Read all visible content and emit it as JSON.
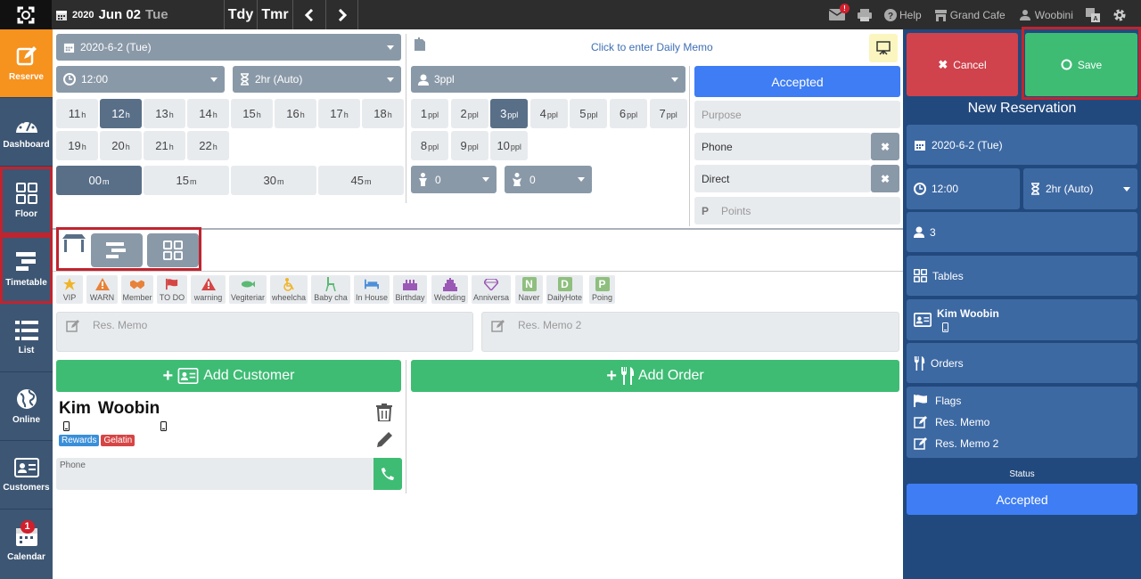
{
  "topbar": {
    "year": "2020",
    "date": "Jun 02",
    "weekday": "Tue",
    "today_label": "Tdy",
    "tomorrow_label": "Tmr",
    "mail_badge": "!",
    "help_label": "Help",
    "venue_label": "Grand Cafe",
    "user_label": "Woobini"
  },
  "sidebar": {
    "items": [
      {
        "label": "Reserve"
      },
      {
        "label": "Dashboard"
      },
      {
        "label": "Floor"
      },
      {
        "label": "Timetable"
      },
      {
        "label": "List"
      },
      {
        "label": "Online"
      },
      {
        "label": "Customers"
      },
      {
        "label": "Calendar",
        "badge": "1"
      }
    ]
  },
  "form": {
    "date_value": "2020-6-2 (Tue)",
    "memo_prompt": "Click to enter Daily Memo",
    "time_value": "12:00",
    "duration_value": "2hr (Auto)",
    "party_value": "3ppl",
    "status_value": "Accepted",
    "purpose_placeholder": "Purpose",
    "source_type": "Phone",
    "channel": "Direct",
    "points_placeholder": "Points",
    "points_icon": "P",
    "hours": [
      "11",
      "12",
      "13",
      "14",
      "15",
      "16",
      "17",
      "18",
      "19",
      "20",
      "21",
      "22"
    ],
    "hour_unit": "h",
    "selected_hour": "12",
    "minutes": [
      "00",
      "15",
      "30",
      "45"
    ],
    "minute_unit": "m",
    "selected_minute": "00",
    "ppl": [
      "1",
      "2",
      "3",
      "4",
      "5",
      "6",
      "7",
      "8",
      "9",
      "10"
    ],
    "ppl_unit": "ppl",
    "selected_ppl": "3",
    "children_value": "0",
    "infants_value": "0"
  },
  "tags": [
    {
      "label": "VIP",
      "icon": "star-icon",
      "color": "#f0b429"
    },
    {
      "label": "WARN",
      "icon": "warning-icon",
      "color": "#e8823a"
    },
    {
      "label": "Member",
      "icon": "handshake-icon",
      "color": "#e8823a"
    },
    {
      "label": "TO DO",
      "icon": "flag-icon",
      "color": "#d64545"
    },
    {
      "label": "warning",
      "icon": "warning-icon",
      "color": "#d64545"
    },
    {
      "label": "Vegiteriar",
      "icon": "fish-icon",
      "color": "#5bb974"
    },
    {
      "label": "wheelcha",
      "icon": "wheelchair-icon",
      "color": "#f0b429"
    },
    {
      "label": "Baby cha",
      "icon": "baby-chair-icon",
      "color": "#5bb974"
    },
    {
      "label": "In House",
      "icon": "bed-icon",
      "color": "#4a8fd9"
    },
    {
      "label": "Birthday",
      "icon": "cake-icon",
      "color": "#9b59b6"
    },
    {
      "label": "Wedding",
      "icon": "wedding-cake-icon",
      "color": "#9b59b6"
    },
    {
      "label": "Anniversa",
      "icon": "diamond-icon",
      "color": "#9b59b6"
    },
    {
      "label": "Naver",
      "icon": "n-icon",
      "letter": "N",
      "color": "#8fbf7f"
    },
    {
      "label": "DailyHote",
      "icon": "d-icon",
      "letter": "D",
      "color": "#8fbf7f"
    },
    {
      "label": "Poing",
      "icon": "p-icon",
      "letter": "P",
      "color": "#8fbf7f"
    }
  ],
  "memos": {
    "memo1_placeholder": "Res. Memo",
    "memo2_placeholder": "Res. Memo 2"
  },
  "buttons": {
    "add_customer": "Add Customer",
    "add_order": "Add Order"
  },
  "customer": {
    "first_name": "Kim",
    "last_name": "Woobin",
    "badges": [
      {
        "label": "Rewards",
        "color": "#3a8fd9"
      },
      {
        "label": "Gelatin",
        "color": "#d64545"
      }
    ],
    "phone_label": "Phone"
  },
  "panel": {
    "cancel_label": "Cancel",
    "save_label": "Save",
    "title": "New Reservation",
    "date": "2020-6-2 (Tue)",
    "time": "12:00",
    "duration": "2hr (Auto)",
    "party": "3",
    "tables_label": "Tables",
    "customer_name": "Kim Woobin",
    "orders_label": "Orders",
    "flags_label": "Flags",
    "memo_label": "Res. Memo",
    "memo2_label": "Res. Memo 2",
    "status_caption": "Status",
    "status_value": "Accepted"
  },
  "colors": {
    "accent_blue": "#3e7df4",
    "green": "#3ebc74",
    "red": "#d0424c",
    "sidebar": "#3d5673",
    "panel": "#22497d",
    "reserve_orange": "#f6921e"
  }
}
